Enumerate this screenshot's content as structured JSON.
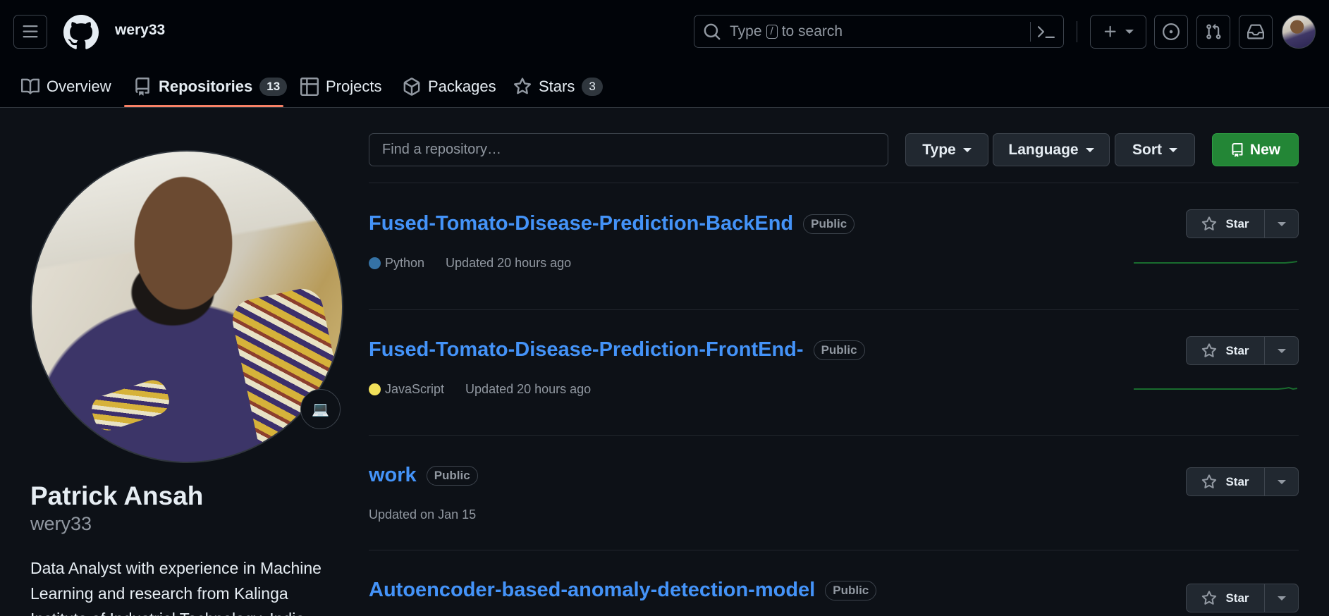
{
  "header": {
    "owner": "wery33",
    "search_placeholder_pre": "Type",
    "search_placeholder_key": "/",
    "search_placeholder_post": "to search"
  },
  "tabs": [
    {
      "label": "Overview",
      "icon": "book-icon"
    },
    {
      "label": "Repositories",
      "icon": "repo-icon",
      "count": "13",
      "active": true
    },
    {
      "label": "Projects",
      "icon": "table-icon"
    },
    {
      "label": "Packages",
      "icon": "package-icon"
    },
    {
      "label": "Stars",
      "icon": "star-icon",
      "count": "3"
    }
  ],
  "profile": {
    "name": "Patrick Ansah",
    "login": "wery33",
    "status_emoji": "💻",
    "bio": "Data Analyst with experience in Machine Learning and research from Kalinga Institute of Industrial Technology, India."
  },
  "toolbar": {
    "find_placeholder": "Find a repository…",
    "type_label": "Type",
    "language_label": "Language",
    "sort_label": "Sort",
    "new_label": "New"
  },
  "repos": [
    {
      "name": "Fused-Tomato-Disease-Prediction-BackEnd",
      "visibility": "Public",
      "language": "Python",
      "language_color": "#3572A5",
      "updated": "Updated 20 hours ago",
      "star_label": "Star"
    },
    {
      "name": "Fused-Tomato-Disease-Prediction-FrontEnd-",
      "visibility": "Public",
      "language": "JavaScript",
      "language_color": "#f1e05a",
      "updated": "Updated 20 hours ago",
      "star_label": "Star"
    },
    {
      "name": "work",
      "visibility": "Public",
      "language": "",
      "updated": "Updated on Jan 15",
      "star_label": "Star"
    },
    {
      "name": "Autoencoder-based-anomaly-detection-model",
      "visibility": "Public",
      "language": "",
      "updated": "",
      "star_label": "Star"
    }
  ],
  "colors": {
    "accent_underline": "#f78166",
    "link": "#4493f8",
    "new_button": "#238636",
    "sparkline": "#196c2e"
  }
}
